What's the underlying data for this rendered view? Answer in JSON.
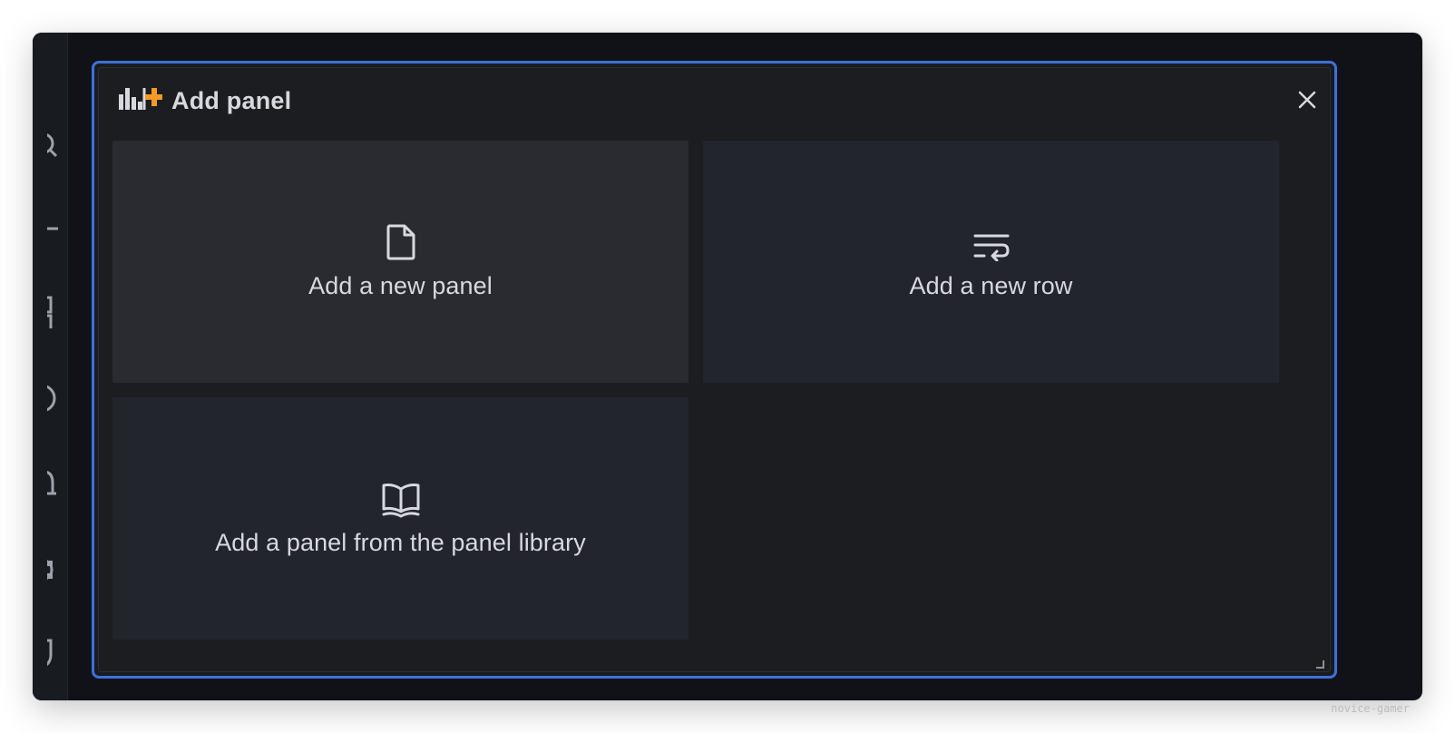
{
  "panel": {
    "title": "Add panel",
    "close_icon": "close-icon",
    "title_icon": "bar-chart-add-icon",
    "accent_color": "#3d71d9",
    "icon_accent_color": "#f69a25"
  },
  "cards": [
    {
      "label": "Add a new panel",
      "icon": "file-blank-icon"
    },
    {
      "label": "Add a new row",
      "icon": "wrap-text-icon"
    },
    {
      "label": "Add a panel from the panel library",
      "icon": "book-open-icon"
    }
  ],
  "sidenav": {
    "icons": [
      "search-icon",
      "plus-icon",
      "apps-icon",
      "compass-icon",
      "bell-icon",
      "cog-icon",
      "shield-icon"
    ]
  },
  "watermark": "novice-gamer"
}
